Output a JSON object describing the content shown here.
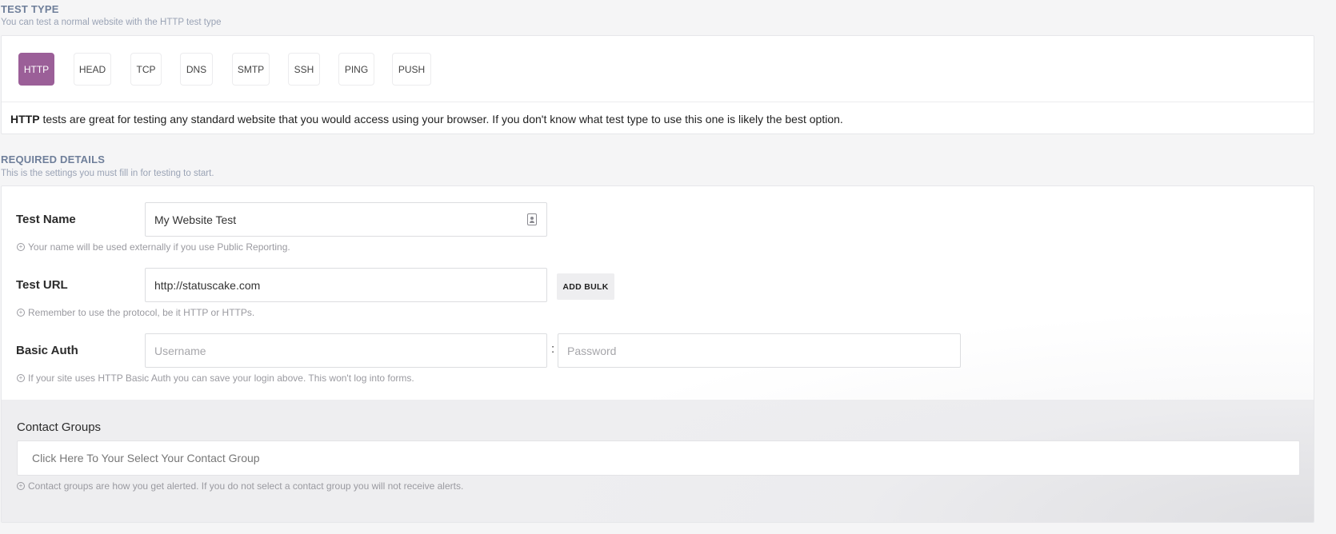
{
  "test_type": {
    "title": "TEST TYPE",
    "subtitle": "You can test a normal website with the HTTP test type",
    "types": [
      "HTTP",
      "HEAD",
      "TCP",
      "DNS",
      "SMTP",
      "SSH",
      "PING",
      "PUSH"
    ],
    "selected": "HTTP",
    "description_bold": "HTTP",
    "description_rest": " tests are great for testing any standard website that you would access using your browser. If you don't know what test type to use this one is likely the best option."
  },
  "required": {
    "title": "REQUIRED DETAILS",
    "subtitle": "This is the settings you must fill in for testing to start.",
    "test_name": {
      "label": "Test Name",
      "value": "My Website Test",
      "hint": "Your name will be used externally if you use Public Reporting."
    },
    "test_url": {
      "label": "Test URL",
      "value": "http://statuscake.com",
      "add_bulk": "ADD BULK",
      "hint": "Remember to use the protocol, be it HTTP or HTTPs."
    },
    "basic_auth": {
      "label": "Basic Auth",
      "username_placeholder": "Username",
      "password_placeholder": "Password",
      "separator": ":",
      "hint": "If your site uses HTTP Basic Auth you can save your login above. This won't log into forms."
    },
    "contact_groups": {
      "label": "Contact Groups",
      "placeholder": "Click Here To Your Select Your Contact Group",
      "hint": "Contact groups are how you get alerted. If you do not select a contact group you will not receive alerts."
    }
  },
  "colors": {
    "accent": "#9b5f98",
    "section_title": "#6f7f9a"
  }
}
